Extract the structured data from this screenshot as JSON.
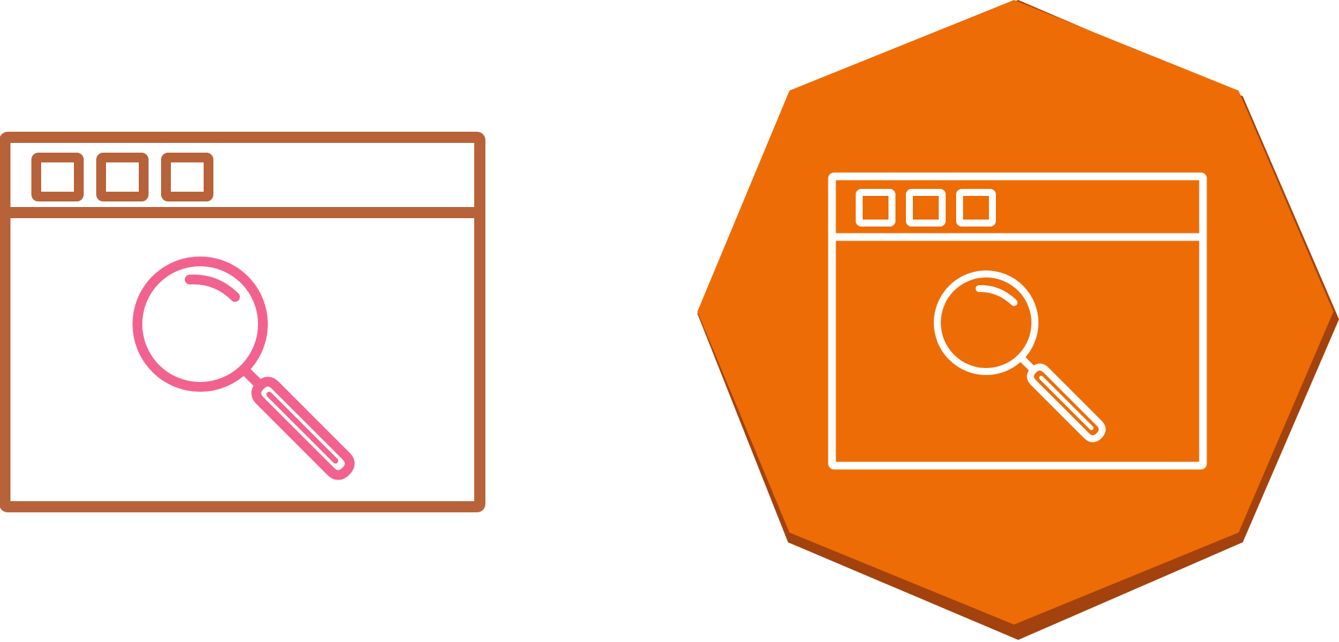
{
  "icons": [
    {
      "name": "browser-search-icon",
      "style": "line",
      "frame_color": "#B8623A",
      "magnifier_color": "#F2628E"
    },
    {
      "name": "browser-search-icon",
      "style": "octagon-badge",
      "badge_color": "#EE6C06",
      "badge_shadow_color": "#A3420D",
      "line_color": "#FFFFFF"
    }
  ],
  "background_color": "#FFFFFF"
}
